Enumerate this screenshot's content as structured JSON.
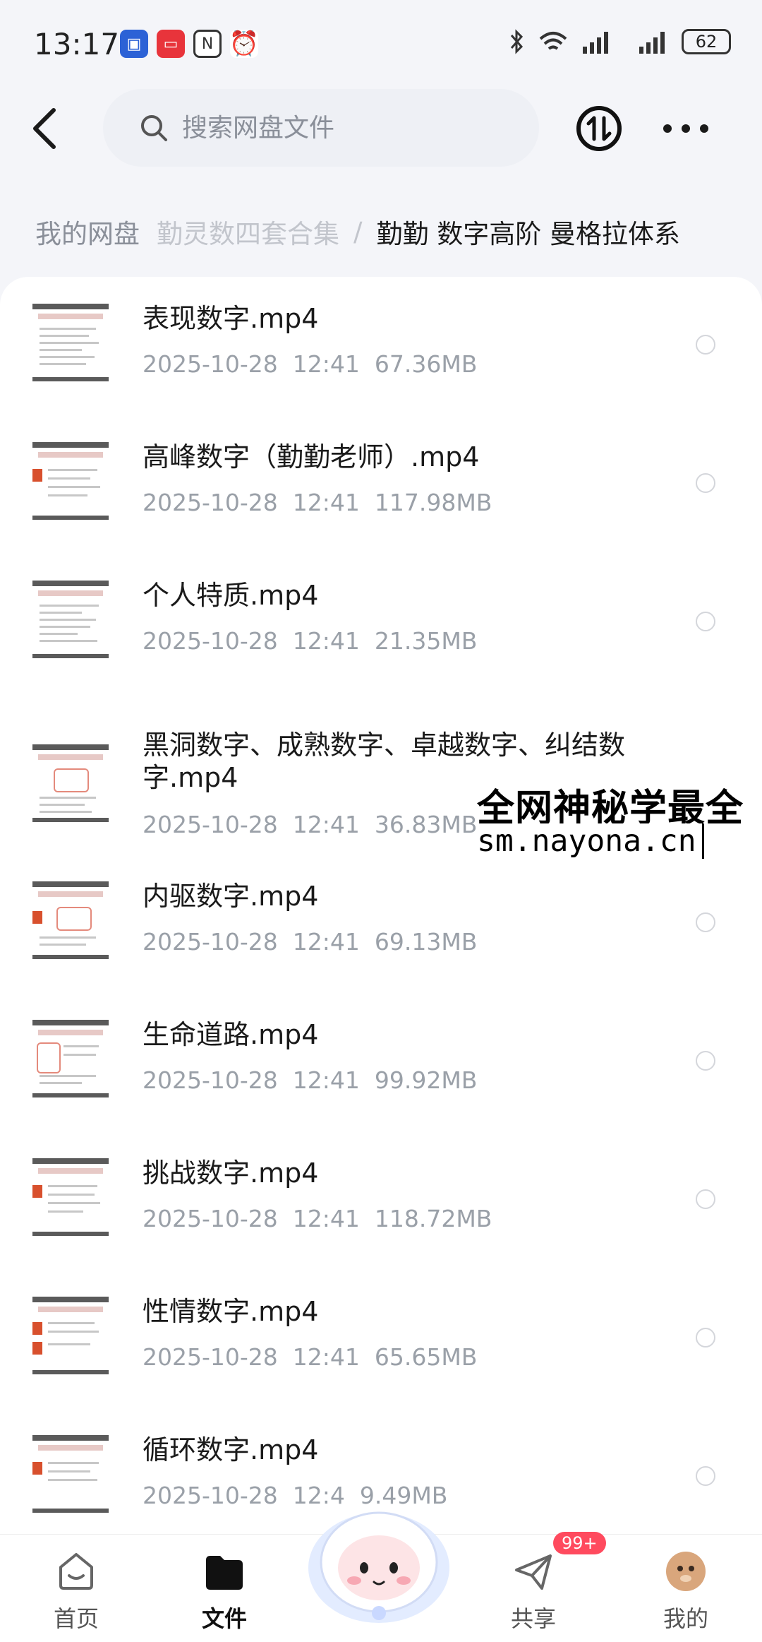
{
  "status_bar": {
    "time": "13:17",
    "battery": "62",
    "app_icons": [
      "calendar-app-icon",
      "message-app-icon",
      "nfc-icon",
      "alarm-icon"
    ],
    "system_icons": [
      "bluetooth-icon",
      "wifi-icon",
      "signal-icon",
      "signal-icon-2"
    ]
  },
  "header": {
    "search_placeholder": "搜索网盘文件"
  },
  "breadcrumb": {
    "root": "我的网盘",
    "middle": "勤灵数四套合集",
    "separator": "/",
    "current": "勤勤  数字高阶 曼格拉体系"
  },
  "files": [
    {
      "name": "表现数字.mp4",
      "date": "2025-10-28",
      "time": "12:41",
      "size": "67.36MB"
    },
    {
      "name": "高峰数字（勤勤老师）.mp4",
      "date": "2025-10-28",
      "time": "12:41",
      "size": "117.98MB"
    },
    {
      "name": "个人特质.mp4",
      "date": "2025-10-28",
      "time": "12:41",
      "size": "21.35MB"
    },
    {
      "name": "黑洞数字、成熟数字、卓越数字、纠结数字.mp4",
      "date": "2025-10-28",
      "time": "12:41",
      "size": "36.83MB"
    },
    {
      "name": "内驱数字.mp4",
      "date": "2025-10-28",
      "time": "12:41",
      "size": "69.13MB"
    },
    {
      "name": "生命道路.mp4",
      "date": "2025-10-28",
      "time": "12:41",
      "size": "99.92MB"
    },
    {
      "name": "挑战数字.mp4",
      "date": "2025-10-28",
      "time": "12:41",
      "size": "118.72MB"
    },
    {
      "name": "性情数字.mp4",
      "date": "2025-10-28",
      "time": "12:41",
      "size": "65.65MB"
    },
    {
      "name": "循环数字.mp4",
      "date": "2025-10-28",
      "time": "12:4",
      "size": "9.49MB"
    }
  ],
  "watermark": {
    "line1": "全网神秘学最全",
    "line2": "sm.nayona.cn"
  },
  "nav": {
    "home": "首页",
    "files": "文件",
    "share": "共享",
    "share_badge": "99+",
    "mine": "我的"
  },
  "colors": {
    "background": "#f4f5f9",
    "meta_text": "#9aa0a8",
    "badge": "#ff4a5e"
  }
}
